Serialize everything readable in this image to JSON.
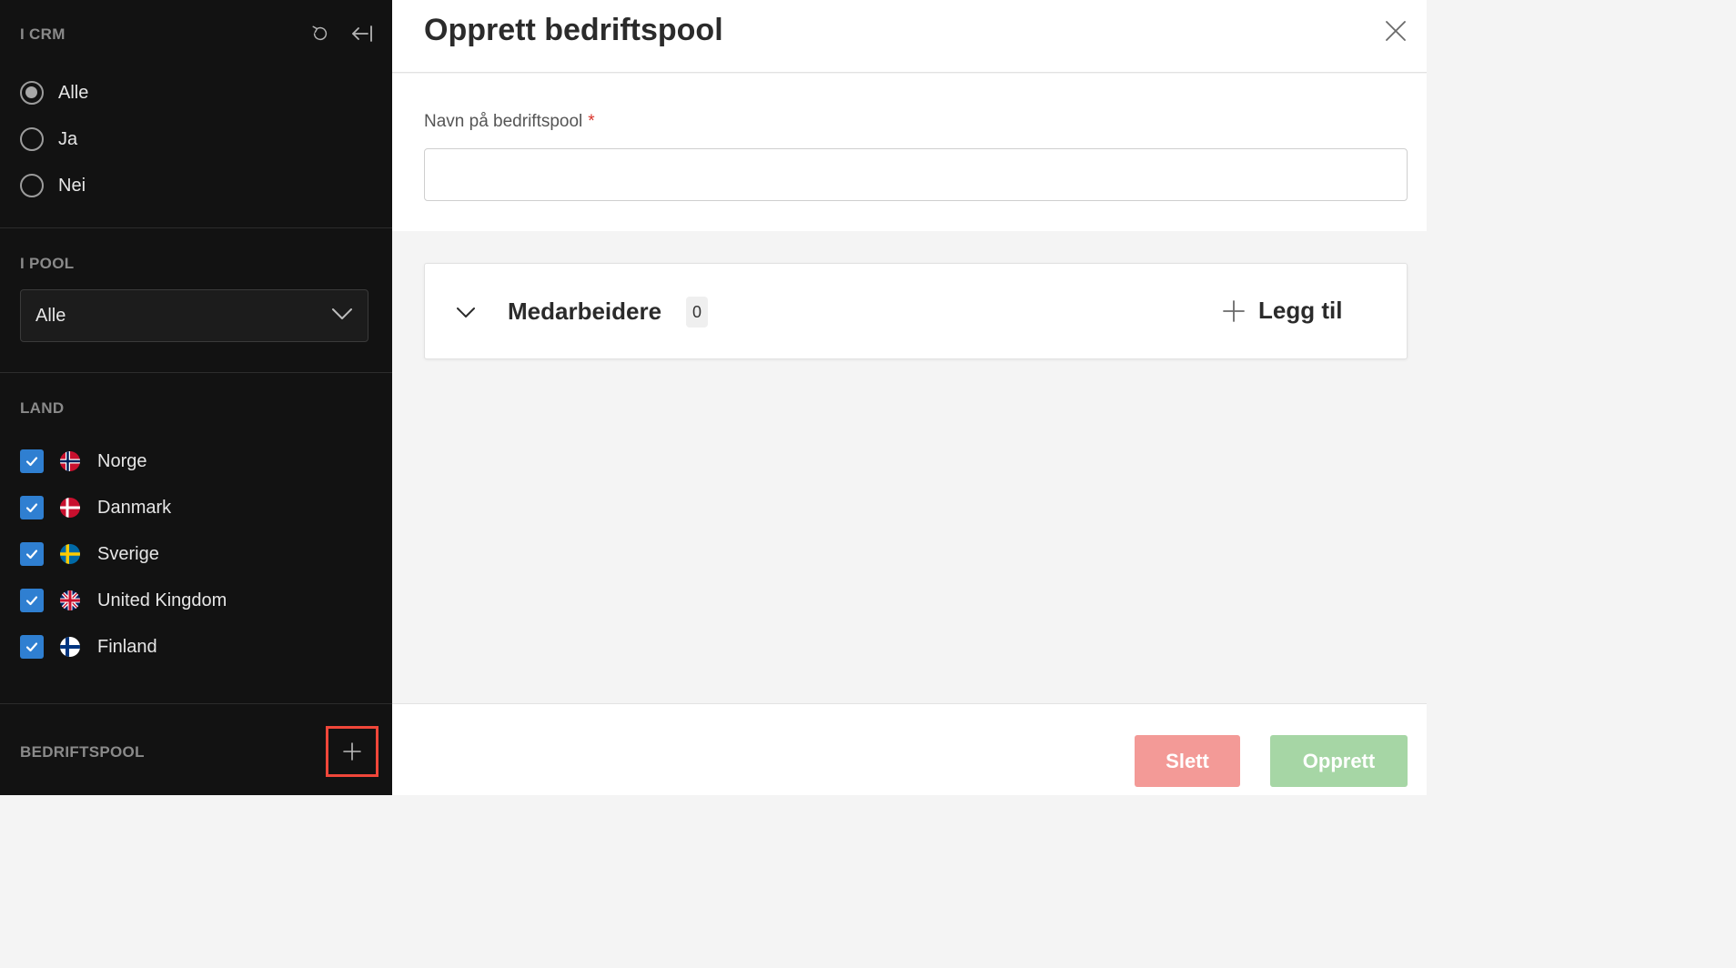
{
  "sidebar": {
    "crm": {
      "heading": "I CRM",
      "options": [
        "Alle",
        "Ja",
        "Nei"
      ],
      "selected": "Alle"
    },
    "pool": {
      "heading": "I POOL",
      "selected_value": "Alle"
    },
    "land": {
      "heading": "LAND",
      "countries": [
        "Norge",
        "Danmark",
        "Sverige",
        "United Kingdom",
        "Finland"
      ]
    },
    "bedriftspool": {
      "heading": "BEDRIFTSPOOL"
    }
  },
  "modal": {
    "title": "Opprett bedriftspool",
    "name_field": {
      "label": "Navn på bedriftspool",
      "required_marker": "*",
      "value": ""
    },
    "section": {
      "title": "Medarbeidere",
      "count": "0",
      "add_label": "Legg til"
    },
    "buttons": {
      "delete_label": "Slett",
      "create_label": "Opprett"
    }
  },
  "colors": {
    "sidebar_bg": "#121212",
    "checkbox_blue": "#2f7fd1",
    "delete_button": "#f39a97",
    "create_button": "#a6d6a5",
    "highlight_red": "#f0473a",
    "required_red": "#d9342b"
  },
  "icons": {
    "reset": "reset-icon",
    "collapse": "collapse-sidebar-icon",
    "close": "close-icon",
    "chevron": "chevron-down-icon",
    "plus": "plus-icon",
    "check": "check-icon"
  }
}
